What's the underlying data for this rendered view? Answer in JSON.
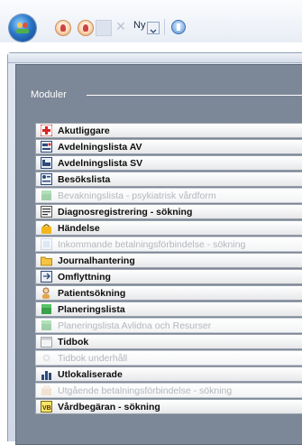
{
  "toolbar": {
    "new_label": "Ny"
  },
  "panel": {
    "title": "Moduler"
  },
  "modules": [
    {
      "label": "Akutliggare",
      "icon": "red-cross-icon",
      "enabled": true
    },
    {
      "label": "Avdelningslista AV",
      "icon": "bed-list-icon",
      "enabled": true
    },
    {
      "label": "Avdelningslista SV",
      "icon": "bed-icon",
      "enabled": true
    },
    {
      "label": "Besökslista",
      "icon": "visitor-list-icon",
      "enabled": true
    },
    {
      "label": "Bevakningslista - psykiatrisk vårdform",
      "icon": "green-square-icon",
      "enabled": false
    },
    {
      "label": "Diagnosregistrering - sökning",
      "icon": "diagnosis-icon",
      "enabled": true
    },
    {
      "label": "Händelse",
      "icon": "event-icon",
      "enabled": true
    },
    {
      "label": "Inkommande betalningsförbindelse - sökning",
      "icon": "incoming-payment-icon",
      "enabled": false
    },
    {
      "label": "Journalhantering",
      "icon": "folder-icon",
      "enabled": true
    },
    {
      "label": "Omflyttning",
      "icon": "relocation-icon",
      "enabled": true
    },
    {
      "label": "Patientsökning",
      "icon": "patient-search-icon",
      "enabled": true
    },
    {
      "label": "Planeringslista",
      "icon": "green-square-icon",
      "enabled": true
    },
    {
      "label": "Planeringslista Avlidna och Resurser",
      "icon": "green-square-icon",
      "enabled": false
    },
    {
      "label": "Tidbok",
      "icon": "calendar-icon",
      "enabled": true
    },
    {
      "label": "Tidbok underhåll",
      "icon": "gear-icon",
      "enabled": false
    },
    {
      "label": "Utlokaliserade",
      "icon": "chart-icon",
      "enabled": true
    },
    {
      "label": "Utgående betalningsförbindelse - sökning",
      "icon": "outgoing-payment-icon",
      "enabled": false
    },
    {
      "label": "Vårdbegäran - sökning",
      "icon": "care-request-icon",
      "enabled": true
    }
  ],
  "colors": {
    "panel_bg": "#7c8797",
    "item_text": "#0d0d0d",
    "disabled_text": "#b3b7bd"
  }
}
